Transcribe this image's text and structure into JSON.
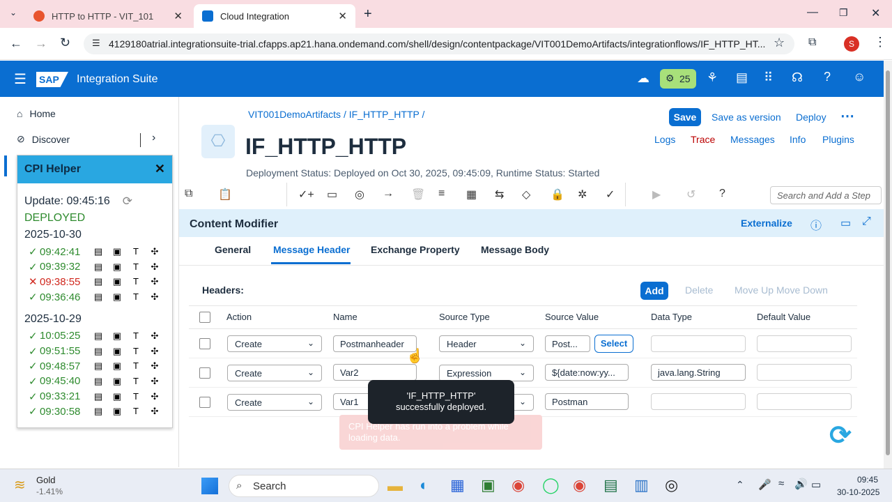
{
  "browser": {
    "tabs": [
      {
        "title": "HTTP to HTTP - VIT_101"
      },
      {
        "title": "Cloud Integration"
      }
    ],
    "url": "4129180atrial.integrationsuite-trial.cfapps.ap21.hana.ondemand.com/shell/design/contentpackage/VIT001DemoArtifacts/integrationflows/IF_HTTP_HT...",
    "profile_initial": "S"
  },
  "shell": {
    "logo": "SAP",
    "product": "Integration Suite",
    "badge_count": "25"
  },
  "leftnav": {
    "items": [
      {
        "label": "Home"
      },
      {
        "label": "Discover"
      }
    ]
  },
  "cpi_helper": {
    "title": "CPI Helper",
    "update": "Update: 09:45:16",
    "status": "DEPLOYED",
    "groups": [
      {
        "date": "2025-10-30",
        "runs": [
          {
            "mark": "✓",
            "time": "09:42:41",
            "color": "#2e8b2e"
          },
          {
            "mark": "✓",
            "time": "09:39:32",
            "color": "#2e8b2e"
          },
          {
            "mark": "✕",
            "time": "09:38:55",
            "color": "#d0271d"
          },
          {
            "mark": "✓",
            "time": "09:36:46",
            "color": "#2e8b2e"
          }
        ]
      },
      {
        "date": "2025-10-29",
        "runs": [
          {
            "mark": "✓",
            "time": "10:05:25",
            "color": "#2e8b2e"
          },
          {
            "mark": "✓",
            "time": "09:51:55",
            "color": "#2e8b2e"
          },
          {
            "mark": "✓",
            "time": "09:48:57",
            "color": "#2e8b2e"
          },
          {
            "mark": "✓",
            "time": "09:45:40",
            "color": "#2e8b2e"
          },
          {
            "mark": "✓",
            "time": "09:33:21",
            "color": "#2e8b2e"
          },
          {
            "mark": "✓",
            "time": "09:30:58",
            "color": "#2e8b2e"
          }
        ]
      }
    ]
  },
  "header": {
    "breadcrumb": [
      "VIT001DemoArtifacts",
      "IF_HTTP_HTTP"
    ],
    "title": "IF_HTTP_HTTP",
    "deployment_status": "Deployment Status: Deployed on Oct 30, 2025, 09:45:09, Runtime Status: Started",
    "actions": {
      "save": "Save",
      "save_version": "Save as version",
      "deploy": "Deploy"
    },
    "links": {
      "logs": "Logs",
      "trace": "Trace",
      "messages": "Messages",
      "info": "Info",
      "plugins": "Plugins"
    }
  },
  "toolbar": {
    "search_placeholder": "Search and Add a Step"
  },
  "panel": {
    "title": "Content Modifier",
    "externalize": "Externalize",
    "tabs": [
      "General",
      "Message Header",
      "Exchange Property",
      "Message Body"
    ],
    "active_tab": "Message Header",
    "headers_label": "Headers:",
    "buttons": {
      "add": "Add",
      "delete": "Delete",
      "move_up": "Move Up",
      "move_down": "Move Down"
    },
    "columns": [
      "Action",
      "Name",
      "Source Type",
      "Source Value",
      "Data Type",
      "Default Value"
    ],
    "rows": [
      {
        "action": "Create",
        "name": "Postmanheader",
        "source_type": "Header",
        "source_value": "Post...",
        "data_type": "",
        "default": ""
      },
      {
        "action": "Create",
        "name": "Var2",
        "source_type": "Expression",
        "source_value": "${date:now:yy...",
        "data_type": "java.lang.String",
        "default": ""
      },
      {
        "action": "Create",
        "name": "Var1",
        "source_type": "",
        "source_value": "Postman",
        "data_type": "",
        "default": ""
      }
    ],
    "select_label": "Select"
  },
  "toast": {
    "line1": "'IF_HTTP_HTTP'",
    "line2": "successfully deployed."
  },
  "error_toast": {
    "line1": "CPI Helper has run into a problem while",
    "line2": "loading data."
  },
  "taskbar": {
    "stock_name": "Gold",
    "stock_change": "-1.41%",
    "search": "Search",
    "time": "09:45",
    "date": "30-10-2025"
  }
}
